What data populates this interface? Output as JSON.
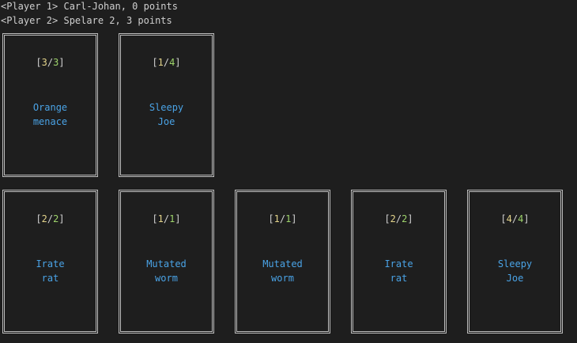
{
  "status": {
    "player1": "<Player 1> Carl-Johan, 0 points",
    "player2": "<Player 2> Spelare 2, 3 points"
  },
  "colors": {
    "background": "#1e1e1e",
    "text": "#cfcfcf",
    "card_border": "#bdbdbd",
    "card_name": "#4aa3e6",
    "attack": "#e3d38a",
    "health": "#9ed36b"
  },
  "opponent_cards": [
    {
      "attack": "3",
      "health": "3",
      "name_line1": "Orange",
      "name_line2": "menace"
    },
    {
      "attack": "1",
      "health": "4",
      "name_line1": "Sleepy",
      "name_line2": "Joe"
    }
  ],
  "player_cards": [
    {
      "attack": "2",
      "health": "2",
      "name_line1": "Irate",
      "name_line2": "rat"
    },
    {
      "attack": "1",
      "health": "1",
      "name_line1": "Mutated",
      "name_line2": "worm"
    },
    {
      "attack": "1",
      "health": "1",
      "name_line1": "Mutated",
      "name_line2": "worm"
    },
    {
      "attack": "2",
      "health": "2",
      "name_line1": "Irate",
      "name_line2": "rat"
    },
    {
      "attack": "4",
      "health": "4",
      "name_line1": "Sleepy",
      "name_line2": "Joe"
    }
  ]
}
